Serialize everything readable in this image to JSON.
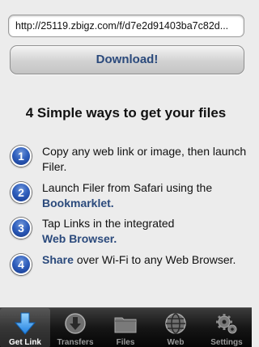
{
  "url_field": {
    "value": "http://25119.zbigz.com/f/d7e2d91403ba7c82d..."
  },
  "download_button": {
    "label": "Download!"
  },
  "heading": "4 Simple ways to get your files",
  "steps": [
    {
      "number": "1",
      "text": "Copy any web link or image, then launch Filer."
    },
    {
      "number": "2",
      "text": "Launch Filer from Safari using the",
      "link": "Bookmarklet."
    },
    {
      "number": "3",
      "text": "Tap Links in the integrated",
      "link": "Web Browser."
    },
    {
      "number": "4",
      "link": "Share",
      "text": "over Wi-Fi to any Web Browser."
    }
  ],
  "tabs": [
    {
      "label": "Get Link",
      "icon": "download-arrow-icon",
      "active": true
    },
    {
      "label": "Transfers",
      "icon": "transfers-icon",
      "active": false
    },
    {
      "label": "Files",
      "icon": "folder-icon",
      "active": false
    },
    {
      "label": "Web",
      "icon": "globe-icon",
      "active": false
    },
    {
      "label": "Settings",
      "icon": "gear-icon",
      "active": false
    }
  ],
  "colors": {
    "accent": "#2b4a7c",
    "step_badge": "#2f5fbd",
    "tabbar": "#161616",
    "active_icon": "#3aa0f0"
  }
}
